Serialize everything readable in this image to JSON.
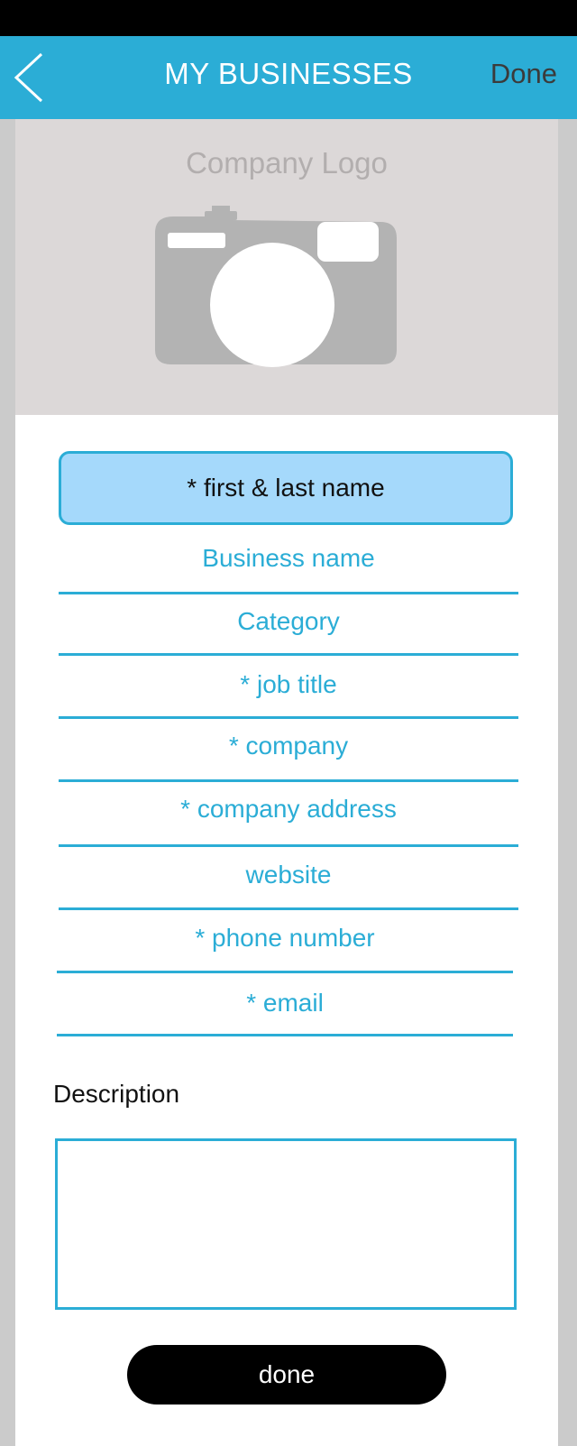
{
  "header": {
    "title": "MY BUSINESSES",
    "done_label": "Done",
    "back_icon": "chevron-left-icon",
    "color": "#2badd6"
  },
  "logo": {
    "label": "Company Logo",
    "icon": "camera-icon"
  },
  "form": {
    "name_placeholder": "* first & last name",
    "fields": [
      {
        "placeholder": "Business name"
      },
      {
        "placeholder": "Category"
      },
      {
        "placeholder": "* job title"
      },
      {
        "placeholder": "* company"
      },
      {
        "placeholder": "* company address"
      },
      {
        "placeholder": "website"
      },
      {
        "placeholder": "* phone number"
      },
      {
        "placeholder": "* email"
      }
    ],
    "description_label": "Description",
    "description_value": "",
    "submit_label": "done"
  },
  "colors": {
    "accent": "#2badd6",
    "highlight_field": "#a5d9fb",
    "logo_background": "#dcd8d8"
  }
}
